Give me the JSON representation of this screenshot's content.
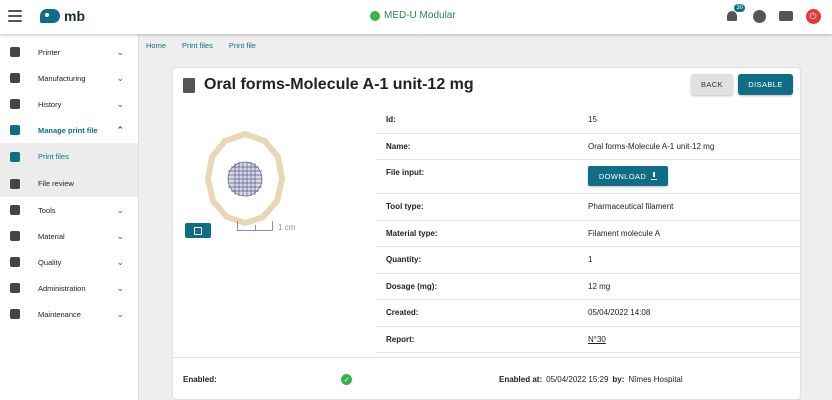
{
  "topbar": {
    "logo_text": "mb",
    "status_text": "MED-U Modular",
    "notifications_count": "30"
  },
  "sidebar": {
    "items": [
      {
        "label": "Printer",
        "icon": "printer-icon"
      },
      {
        "label": "Manufacturing",
        "icon": "manufacturing-icon"
      },
      {
        "label": "History",
        "icon": "history-icon"
      },
      {
        "label": "Manage print file",
        "icon": "manage-print-file-icon"
      },
      {
        "label": "Print files",
        "icon": "print-files-icon"
      },
      {
        "label": "File review",
        "icon": "file-review-icon"
      },
      {
        "label": "Tools",
        "icon": "tools-icon"
      },
      {
        "label": "Material",
        "icon": "material-icon"
      },
      {
        "label": "Quality",
        "icon": "quality-icon"
      },
      {
        "label": "Administration",
        "icon": "administration-icon"
      },
      {
        "label": "Maintenance",
        "icon": "maintenance-icon"
      }
    ]
  },
  "breadcrumb": [
    "Home",
    "Print files",
    "Print file"
  ],
  "card": {
    "title": "Oral forms-Molecule A-1 unit-12 mg",
    "back_label": "BACK",
    "disable_label": "DISABLE",
    "scale_label": "1 cm",
    "download_label": "DOWNLOAD",
    "fields": [
      {
        "key": "Id:",
        "value": "15"
      },
      {
        "key": "Name:",
        "value": "Oral forms-Molecule A-1 unit-12 mg"
      },
      {
        "key": "File input:",
        "value": ""
      },
      {
        "key": "Tool type:",
        "value": "Pharmaceutical filament"
      },
      {
        "key": "Material type:",
        "value": "Filament molecule A"
      },
      {
        "key": "Quantity:",
        "value": "1"
      },
      {
        "key": "Dosage (mg):",
        "value": "12 mg"
      },
      {
        "key": "Created:",
        "value": "05/04/2022 14:08"
      },
      {
        "key": "Report:",
        "value": "N°30"
      }
    ],
    "footer": {
      "enabled_label": "Enabled:",
      "enabled_at_label": "Enabled at:",
      "enabled_at_value": "05/04/2022 15:29",
      "by_label": "by:",
      "by_value": "Nîmes Hospital"
    }
  },
  "colors": {
    "accent": "#0f6e86",
    "status_green": "#3cb44b",
    "power_red": "#e53935"
  }
}
